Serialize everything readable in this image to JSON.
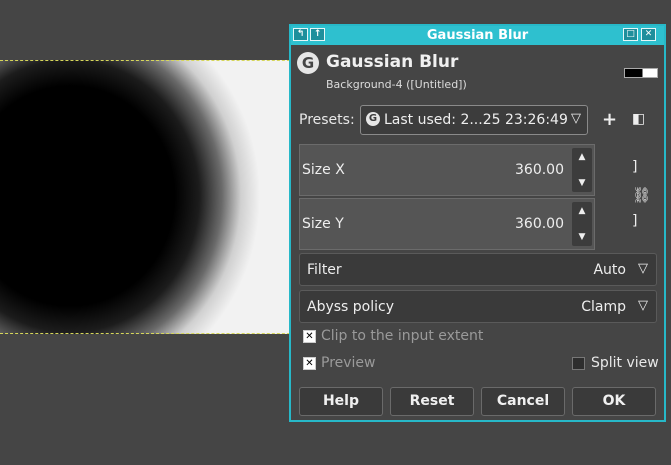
{
  "dialog": {
    "window_title": "Gaussian Blur",
    "header_title": "Gaussian Blur",
    "header_subtitle": "Background-4 ([Untitled])",
    "logo_glyph": "G",
    "presets_label": "Presets:",
    "preset_value": "Last used: 2...25 23:26:49",
    "size_x": {
      "label": "Size X",
      "value": "360.00"
    },
    "size_y": {
      "label": "Size Y",
      "value": "360.00"
    },
    "filter": {
      "label": "Filter",
      "value": "Auto"
    },
    "abyss": {
      "label": "Abyss policy",
      "value": "Clamp"
    },
    "clip_label": "Clip to the input extent",
    "preview_label": "Preview",
    "split_label": "Split view",
    "buttons": {
      "help": "Help",
      "reset": "Reset",
      "cancel": "Cancel",
      "ok": "OK"
    }
  },
  "colors": {
    "titlebar": "#2ec0cf",
    "dialog_bg": "#454545"
  },
  "icons": [
    "gimp-logo-icon",
    "chevron-down-icon",
    "plus-icon",
    "manage-presets-icon",
    "chain-link-icon",
    "spin-up-icon",
    "spin-down-icon",
    "maximize-icon",
    "close-icon",
    "pin-icon",
    "checkmark-icon"
  ]
}
